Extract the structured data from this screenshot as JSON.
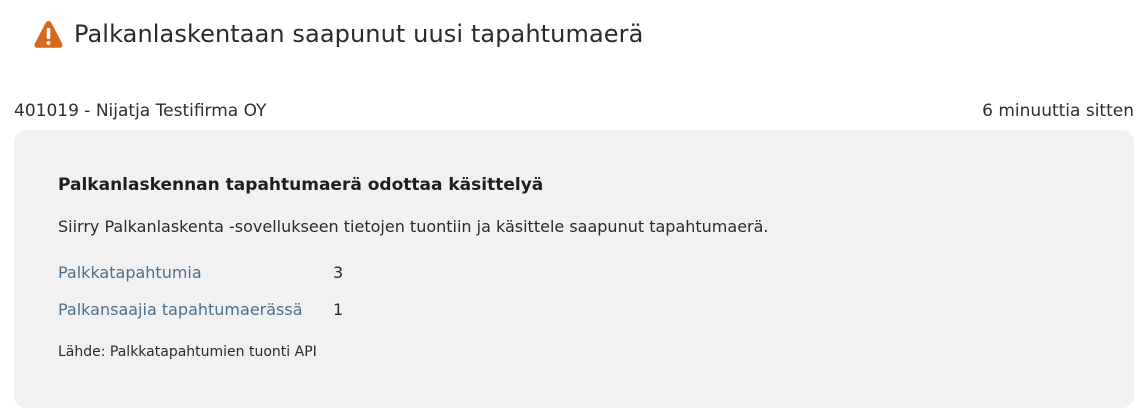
{
  "header": {
    "icon": "warning-icon",
    "title": "Palkanlaskentaan saapunut uusi tapahtumaerä",
    "accent_color": "#d46a1a"
  },
  "meta": {
    "company": "401019 - Nijatja Testifirma OY",
    "time_ago": "6 minuuttia sitten"
  },
  "card": {
    "title": "Palkanlaskennan tapahtumaerä odottaa käsittelyä",
    "description": "Siirry Palkanlaskenta -sovellukseen tietojen tuontiin ja käsittele saapunut tapahtumaerä.",
    "stats": [
      {
        "label": "Palkkatapahtumia",
        "value": "3"
      },
      {
        "label": "Palkansaajia tapahtumaerässä",
        "value": "1"
      }
    ],
    "source": "Lähde: Palkkatapahtumien tuonti API"
  }
}
